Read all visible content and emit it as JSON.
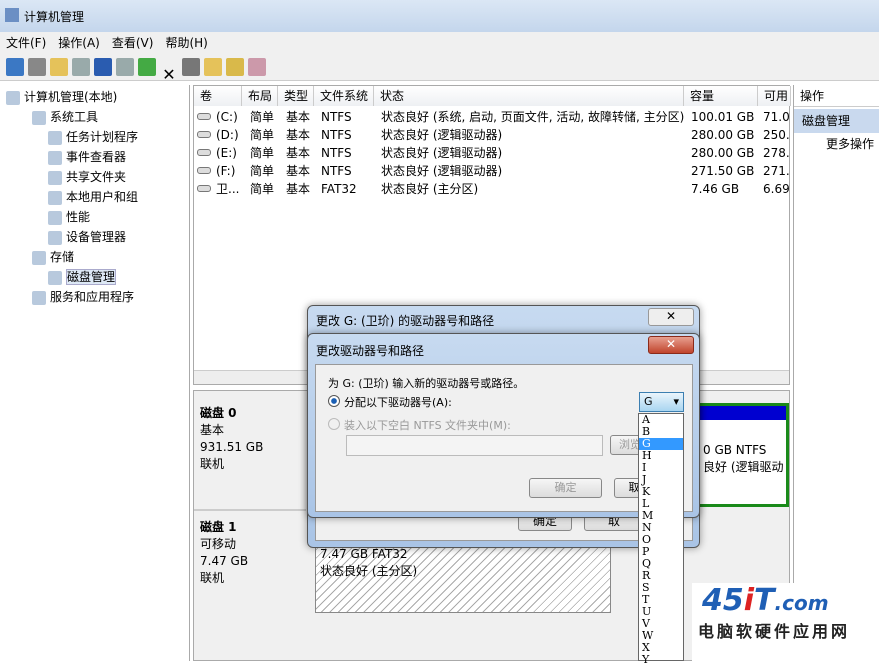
{
  "window": {
    "title": "计算机管理"
  },
  "menu": [
    "文件(F)",
    "操作(A)",
    "查看(V)",
    "帮助(H)"
  ],
  "tree": [
    {
      "label": "计算机管理(本地)",
      "lvl": 0
    },
    {
      "label": "系统工具",
      "lvl": 1
    },
    {
      "label": "任务计划程序",
      "lvl": 2
    },
    {
      "label": "事件查看器",
      "lvl": 2
    },
    {
      "label": "共享文件夹",
      "lvl": 2
    },
    {
      "label": "本地用户和组",
      "lvl": 2
    },
    {
      "label": "性能",
      "lvl": 2
    },
    {
      "label": "设备管理器",
      "lvl": 2
    },
    {
      "label": "存储",
      "lvl": 1
    },
    {
      "label": "磁盘管理",
      "lvl": 2,
      "selected": true
    },
    {
      "label": "服务和应用程序",
      "lvl": 1
    }
  ],
  "columns": [
    "卷",
    "布局",
    "类型",
    "文件系统",
    "状态",
    "容量",
    "可用"
  ],
  "volumes": [
    [
      "(C:)",
      "简单",
      "基本",
      "NTFS",
      "状态良好 (系统, 启动, 页面文件, 活动, 故障转储, 主分区)",
      "100.01 GB",
      "71.0"
    ],
    [
      "(D:)",
      "简单",
      "基本",
      "NTFS",
      "状态良好 (逻辑驱动器)",
      "280.00 GB",
      "250."
    ],
    [
      "(E:)",
      "简单",
      "基本",
      "NTFS",
      "状态良好 (逻辑驱动器)",
      "280.00 GB",
      "278."
    ],
    [
      "(F:)",
      "简单",
      "基本",
      "NTFS",
      "状态良好 (逻辑驱动器)",
      "271.50 GB",
      "271."
    ],
    [
      "卫...",
      "简单",
      "基本",
      "FAT32",
      "状态良好 (主分区)",
      "7.46 GB",
      "6.69"
    ]
  ],
  "actions": {
    "header": "操作",
    "section": "磁盘管理",
    "more": "更多操作"
  },
  "disks": [
    {
      "name": "磁盘 0",
      "type": "基本",
      "size": "931.51 GB",
      "status": "联机"
    },
    {
      "name": "磁盘 1",
      "type": "可移动",
      "size": "7.47 GB",
      "status": "联机"
    }
  ],
  "partition_d1": {
    "size": "7.47 GB FAT32",
    "status": "状态良好 (主分区)"
  },
  "partition_d0": {
    "size": "0 GB NTFS",
    "status": "良好 (逻辑驱动"
  },
  "back_dialog": {
    "title": "更改 G: (卫玠) 的驱动器号和路径",
    "ok": "确定",
    "cancel": "取"
  },
  "dialog": {
    "title": "更改驱动器号和路径",
    "prompt": "为 G: (卫玠) 输入新的驱动器号或路径。",
    "opt_assign": "分配以下驱动器号(A):",
    "opt_mount": "装入以下空白 NTFS 文件夹中(M):",
    "browse": "浏览",
    "ok": "确定",
    "cancel": "取",
    "selected_letter": "G"
  },
  "letters": [
    "A",
    "B",
    "G",
    "H",
    "I",
    "J",
    "K",
    "L",
    "M",
    "N",
    "O",
    "P",
    "Q",
    "R",
    "S",
    "T",
    "U",
    "V",
    "W",
    "X",
    "Y"
  ],
  "watermark": {
    "logo": "45IT.com",
    "tagline": "电脑软硬件应用网"
  }
}
